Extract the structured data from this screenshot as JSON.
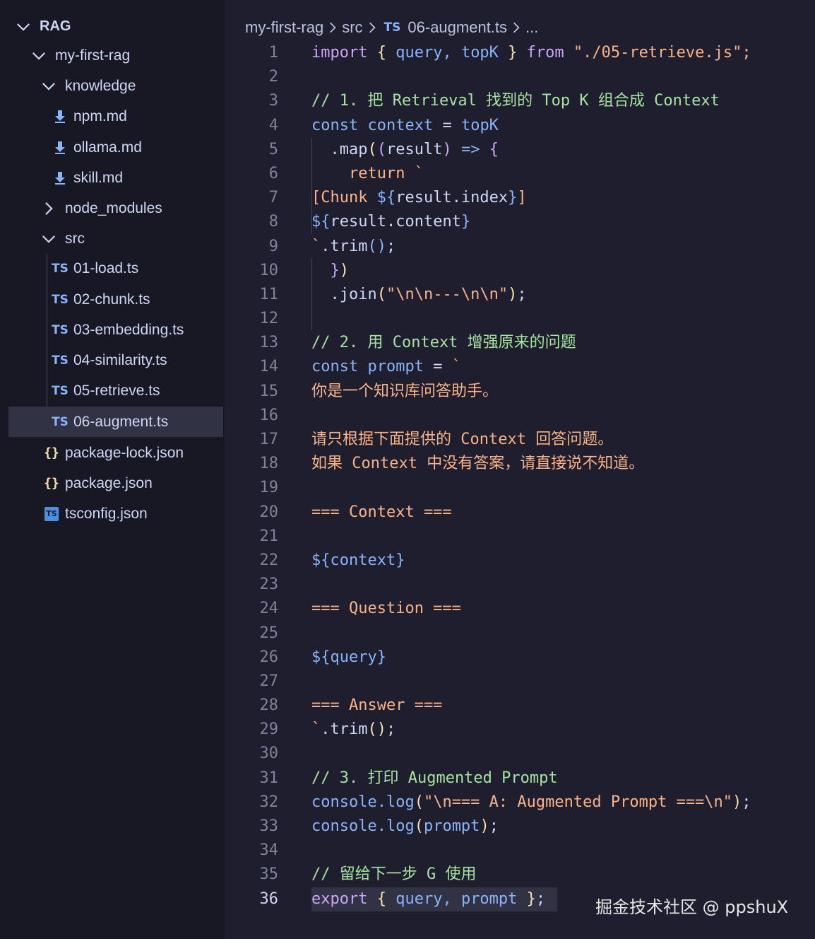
{
  "colors": {
    "editor_bg": "#1e1e2e",
    "sidebar_bg": "#181825",
    "keyword": "#cba6f7",
    "declaration": "#89b4fa",
    "string": "#a6e3a1",
    "template": "#fab387",
    "comment": "#a6e3a1",
    "punctuation": "#f9e2af",
    "text": "#cdd6f4"
  },
  "explorer": {
    "items": [
      {
        "label": "RAG",
        "kind": "root",
        "level": 0,
        "icon": "chevron-down-icon"
      },
      {
        "label": "my-first-rag",
        "kind": "folder-open",
        "level": 1,
        "icon": "chevron-down-icon"
      },
      {
        "label": "knowledge",
        "kind": "folder-open",
        "level": 2,
        "icon": "chevron-down-icon"
      },
      {
        "label": "npm.md",
        "kind": "md",
        "level": 3,
        "icon": "markdown-download-icon"
      },
      {
        "label": "ollama.md",
        "kind": "md",
        "level": 3,
        "icon": "markdown-download-icon"
      },
      {
        "label": "skill.md",
        "kind": "md",
        "level": 3,
        "icon": "markdown-download-icon"
      },
      {
        "label": "node_modules",
        "kind": "folder-closed",
        "level": 2,
        "icon": "chevron-right-icon"
      },
      {
        "label": "src",
        "kind": "folder-open",
        "level": 2,
        "icon": "chevron-down-icon"
      },
      {
        "label": "01-load.ts",
        "kind": "ts",
        "level": 3,
        "icon": "typescript-file-icon",
        "badge": "TS"
      },
      {
        "label": "02-chunk.ts",
        "kind": "ts",
        "level": 3,
        "icon": "typescript-file-icon",
        "badge": "TS"
      },
      {
        "label": "03-embedding.ts",
        "kind": "ts",
        "level": 3,
        "icon": "typescript-file-icon",
        "badge": "TS"
      },
      {
        "label": "04-similarity.ts",
        "kind": "ts",
        "level": 3,
        "icon": "typescript-file-icon",
        "badge": "TS"
      },
      {
        "label": "05-retrieve.ts",
        "kind": "ts",
        "level": 3,
        "icon": "typescript-file-icon",
        "badge": "TS"
      },
      {
        "label": "06-augment.ts",
        "kind": "ts",
        "level": 3,
        "icon": "typescript-file-icon",
        "badge": "TS",
        "selected": true
      },
      {
        "label": "package-lock.json",
        "kind": "json",
        "level": 2,
        "icon": "json-braces-icon",
        "badge": "{}"
      },
      {
        "label": "package.json",
        "kind": "json",
        "level": 2,
        "icon": "json-braces-icon",
        "badge": "{}"
      },
      {
        "label": "tsconfig.json",
        "kind": "tsconfig",
        "level": 2,
        "icon": "tsconfig-file-icon",
        "badge": "TS"
      }
    ]
  },
  "breadcrumb": {
    "segments": [
      "my-first-rag",
      "src",
      "06-augment.ts",
      "..."
    ],
    "file_badge": "TS"
  },
  "editor": {
    "current_line": 36,
    "lines": [
      {
        "n": "1",
        "tokens": [
          [
            "import",
            "keyword"
          ],
          [
            " ",
            "text"
          ],
          [
            "{",
            "punctuation"
          ],
          [
            " query, topK ",
            "declaration"
          ],
          [
            "}",
            "punctuation"
          ],
          [
            " ",
            "text"
          ],
          [
            "from",
            "keyword"
          ],
          [
            " \"./05-retrieve.js\";",
            "template"
          ]
        ]
      },
      {
        "n": "2",
        "tokens": []
      },
      {
        "n": "3",
        "tokens": [
          [
            "// 1. 把 Retrieval 找到的 Top K 组合成 Context",
            "comment"
          ]
        ]
      },
      {
        "n": "4",
        "tokens": [
          [
            "const",
            "declaration"
          ],
          [
            " context ",
            "declaration"
          ],
          [
            "=",
            "text"
          ],
          [
            " topK",
            "declaration"
          ]
        ]
      },
      {
        "n": "5",
        "tokens": [
          [
            "  .map",
            "text"
          ],
          [
            "(",
            "punctuation"
          ],
          [
            "(",
            "keyword"
          ],
          [
            "result",
            "text"
          ],
          [
            ")",
            "keyword"
          ],
          [
            " => ",
            "declaration"
          ],
          [
            "{",
            "keyword"
          ]
        ]
      },
      {
        "n": "6",
        "tokens": [
          [
            "    return `",
            "template"
          ]
        ]
      },
      {
        "n": "7",
        "tokens": [
          [
            "[Chunk ",
            "template"
          ],
          [
            "${",
            "declaration"
          ],
          [
            "result.index",
            "text"
          ],
          [
            "}",
            "declaration"
          ],
          [
            "]",
            "template"
          ]
        ]
      },
      {
        "n": "8",
        "tokens": [
          [
            "${",
            "declaration"
          ],
          [
            "result.content",
            "text"
          ],
          [
            "}",
            "declaration"
          ]
        ]
      },
      {
        "n": "9",
        "tokens": [
          [
            "`",
            "template"
          ],
          [
            ".trim",
            "text"
          ],
          [
            "()",
            "declaration"
          ],
          [
            ";",
            "text"
          ]
        ]
      },
      {
        "n": "10",
        "tokens": [
          [
            "  ",
            "text"
          ],
          [
            "}",
            "keyword"
          ],
          [
            ")",
            "punctuation"
          ]
        ]
      },
      {
        "n": "11",
        "tokens": [
          [
            "  .join",
            "text"
          ],
          [
            "(",
            "punctuation"
          ],
          [
            "\"\\n\\n---\\n\\n\"",
            "template"
          ],
          [
            ")",
            "punctuation"
          ],
          [
            ";",
            "text"
          ]
        ]
      },
      {
        "n": "12",
        "tokens": []
      },
      {
        "n": "13",
        "tokens": [
          [
            "// 2. 用 Context 增强原来的问题",
            "comment"
          ]
        ]
      },
      {
        "n": "14",
        "tokens": [
          [
            "const",
            "declaration"
          ],
          [
            " prompt ",
            "declaration"
          ],
          [
            "=",
            "text"
          ],
          [
            " `",
            "template"
          ]
        ]
      },
      {
        "n": "15",
        "tokens": [
          [
            "你是一个知识库问答助手。",
            "template"
          ]
        ]
      },
      {
        "n": "16",
        "tokens": []
      },
      {
        "n": "17",
        "tokens": [
          [
            "请只根据下面提供的 Context 回答问题。",
            "template"
          ]
        ]
      },
      {
        "n": "18",
        "tokens": [
          [
            "如果 Context 中没有答案，请直接说不知道。",
            "template"
          ]
        ]
      },
      {
        "n": "19",
        "tokens": []
      },
      {
        "n": "20",
        "tokens": [
          [
            "=== Context ===",
            "template"
          ]
        ]
      },
      {
        "n": "21",
        "tokens": []
      },
      {
        "n": "22",
        "tokens": [
          [
            "${",
            "declaration"
          ],
          [
            "context",
            "declaration"
          ],
          [
            "}",
            "declaration"
          ]
        ]
      },
      {
        "n": "23",
        "tokens": []
      },
      {
        "n": "24",
        "tokens": [
          [
            "=== Question ===",
            "template"
          ]
        ]
      },
      {
        "n": "25",
        "tokens": []
      },
      {
        "n": "26",
        "tokens": [
          [
            "${",
            "declaration"
          ],
          [
            "query",
            "declaration"
          ],
          [
            "}",
            "declaration"
          ]
        ]
      },
      {
        "n": "27",
        "tokens": []
      },
      {
        "n": "28",
        "tokens": [
          [
            "=== Answer ===",
            "template"
          ]
        ]
      },
      {
        "n": "29",
        "tokens": [
          [
            "`",
            "template"
          ],
          [
            ".trim",
            "text"
          ],
          [
            "()",
            "punctuation"
          ],
          [
            ";",
            "text"
          ]
        ]
      },
      {
        "n": "30",
        "tokens": []
      },
      {
        "n": "31",
        "tokens": [
          [
            "// 3. 打印 Augmented Prompt",
            "comment"
          ]
        ]
      },
      {
        "n": "32",
        "tokens": [
          [
            "console.log",
            "declaration"
          ],
          [
            "(",
            "punctuation"
          ],
          [
            "\"\\n=== A: Augmented Prompt ===\\n\"",
            "template"
          ],
          [
            ")",
            "punctuation"
          ],
          [
            ";",
            "text"
          ]
        ]
      },
      {
        "n": "33",
        "tokens": [
          [
            "console.log",
            "declaration"
          ],
          [
            "(",
            "punctuation"
          ],
          [
            "prompt",
            "declaration"
          ],
          [
            ")",
            "punctuation"
          ],
          [
            ";",
            "text"
          ]
        ]
      },
      {
        "n": "34",
        "tokens": []
      },
      {
        "n": "35",
        "tokens": [
          [
            "// 留给下一步 G 使用",
            "comment"
          ]
        ]
      },
      {
        "n": "36",
        "tokens": [
          [
            "export",
            "keyword"
          ],
          [
            " ",
            "text"
          ],
          [
            "{",
            "punctuation"
          ],
          [
            " query, prompt ",
            "declaration"
          ],
          [
            "}",
            "punctuation"
          ],
          [
            ";",
            "text"
          ]
        ]
      }
    ]
  },
  "watermark": "掘金技术社区 @ ppshuX"
}
